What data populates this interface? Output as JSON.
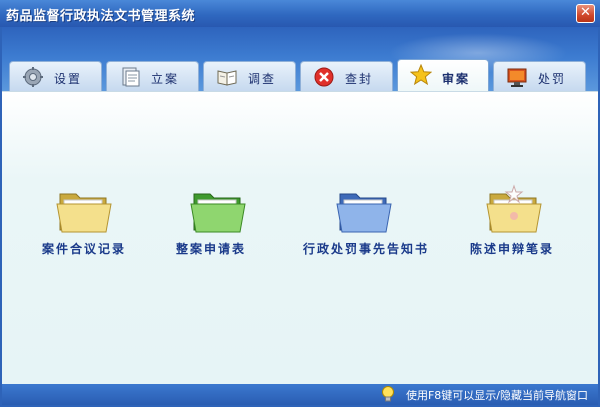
{
  "window": {
    "title": "药品监督行政执法文书管理系统",
    "close_glyph": "✕"
  },
  "tabs": [
    {
      "label": "设置",
      "icon": "gear-icon",
      "active": false
    },
    {
      "label": "立案",
      "icon": "document-icon",
      "active": false
    },
    {
      "label": "调查",
      "icon": "book-icon",
      "active": false
    },
    {
      "label": "查封",
      "icon": "block-icon",
      "active": false
    },
    {
      "label": "审案",
      "icon": "star-icon",
      "active": true
    },
    {
      "label": "处罚",
      "icon": "monitor-icon",
      "active": false
    }
  ],
  "folders": [
    {
      "label": "案件合议记录",
      "color": "yellow"
    },
    {
      "label": "整案申请表",
      "color": "green"
    },
    {
      "label": "行政处罚事先告知书",
      "color": "blue"
    },
    {
      "label": "陈述申辩笔录",
      "color": "yellow-sparkle"
    }
  ],
  "status": {
    "hint": "使用F8键可以显示/隐藏当前导航窗口"
  }
}
